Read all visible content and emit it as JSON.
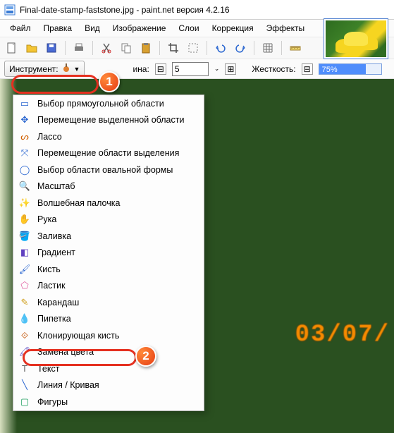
{
  "title": "Final-date-stamp-faststone.jpg - paint.net версия 4.2.16",
  "menu": {
    "file": "Файл",
    "edit": "Правка",
    "view": "Вид",
    "image": "Изображение",
    "layers": "Слои",
    "adjust": "Коррекция",
    "effects": "Эффекты"
  },
  "toolrow": {
    "tool_label": "Инструмент:",
    "width_label": "ина:",
    "width_value": "5",
    "hardness_label": "Жесткость:",
    "hardness_value": "75%",
    "hardness_pct": 75
  },
  "dropdown": {
    "items": [
      {
        "icon": "rect-select-icon",
        "glyph": "▭",
        "color": "#2a66d0",
        "label": "Выбор прямоугольной области"
      },
      {
        "icon": "move-selection-icon",
        "glyph": "✥",
        "color": "#2a66d0",
        "label": "Перемещение выделенной области"
      },
      {
        "icon": "lasso-icon",
        "glyph": "ᔕ",
        "color": "#d06000",
        "label": "Лассо"
      },
      {
        "icon": "move-pixels-icon",
        "glyph": "⤧",
        "color": "#2a66d0",
        "label": "Перемещение области выделения"
      },
      {
        "icon": "ellipse-select-icon",
        "glyph": "◯",
        "color": "#2a66d0",
        "label": "Выбор области овальной формы"
      },
      {
        "icon": "zoom-icon",
        "glyph": "🔍",
        "color": "#2a66d0",
        "label": "Масштаб"
      },
      {
        "icon": "magic-wand-icon",
        "glyph": "✨",
        "color": "#2a66d0",
        "label": "Волшебная палочка"
      },
      {
        "icon": "hand-icon",
        "glyph": "✋",
        "color": "#e08030",
        "label": "Рука"
      },
      {
        "icon": "fill-icon",
        "glyph": "🪣",
        "color": "#2a66d0",
        "label": "Заливка"
      },
      {
        "icon": "gradient-icon",
        "glyph": "◧",
        "color": "#6040c0",
        "label": "Градиент"
      },
      {
        "icon": "brush-icon",
        "glyph": "🖌",
        "color": "#2a66d0",
        "label": "Кисть"
      },
      {
        "icon": "eraser-icon",
        "glyph": "⬠",
        "color": "#e060a0",
        "label": "Ластик"
      },
      {
        "icon": "pencil-icon",
        "glyph": "✎",
        "color": "#d0a020",
        "label": "Карандаш"
      },
      {
        "icon": "eyedropper-icon",
        "glyph": "💧",
        "color": "#2a66d0",
        "label": "Пипетка"
      },
      {
        "icon": "clone-stamp-icon",
        "glyph": "⟐",
        "color": "#c05000",
        "label": "Клонирующая кисть"
      },
      {
        "icon": "recolor-icon",
        "glyph": "🖍",
        "color": "#5040c0",
        "label": "Замена цвета"
      },
      {
        "icon": "text-icon",
        "glyph": "T",
        "color": "#606060",
        "label": "Текст"
      },
      {
        "icon": "line-icon",
        "glyph": "╲",
        "color": "#2a66d0",
        "label": "Линия / Кривая"
      },
      {
        "icon": "shapes-icon",
        "glyph": "▢",
        "color": "#20a060",
        "label": "Фигуры"
      }
    ]
  },
  "date_stamp": "03/07/",
  "badges": {
    "b1": "1",
    "b2": "2"
  }
}
